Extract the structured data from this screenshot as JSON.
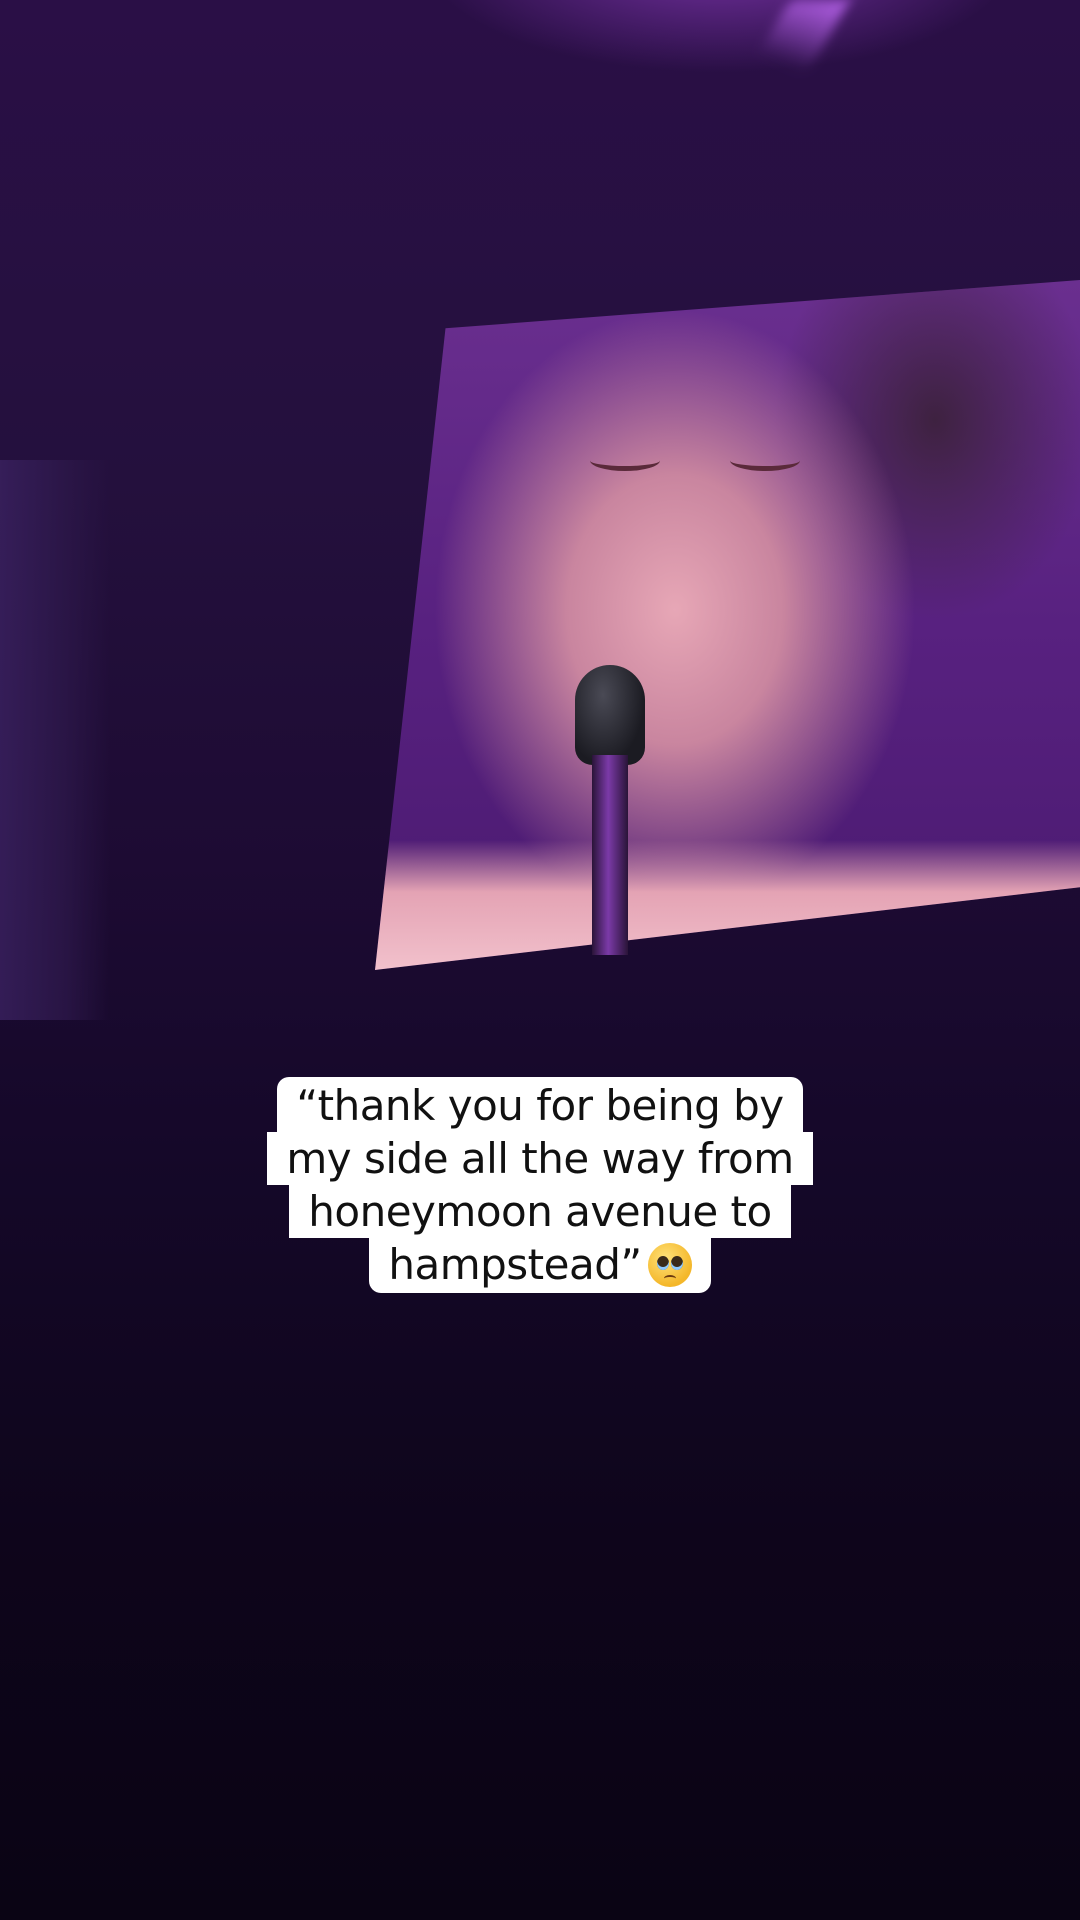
{
  "caption": {
    "lines": [
      "“thank you for being by",
      "my side all the way from",
      "honeymoon avenue to",
      "hampstead”"
    ],
    "emoji": "pleading-face-with-tears-emoji"
  },
  "colors": {
    "caption_background": "#ffffff",
    "caption_text": "#111111",
    "stage_purple": "#2a0f46",
    "screen_purple": "#6a2f8f"
  }
}
